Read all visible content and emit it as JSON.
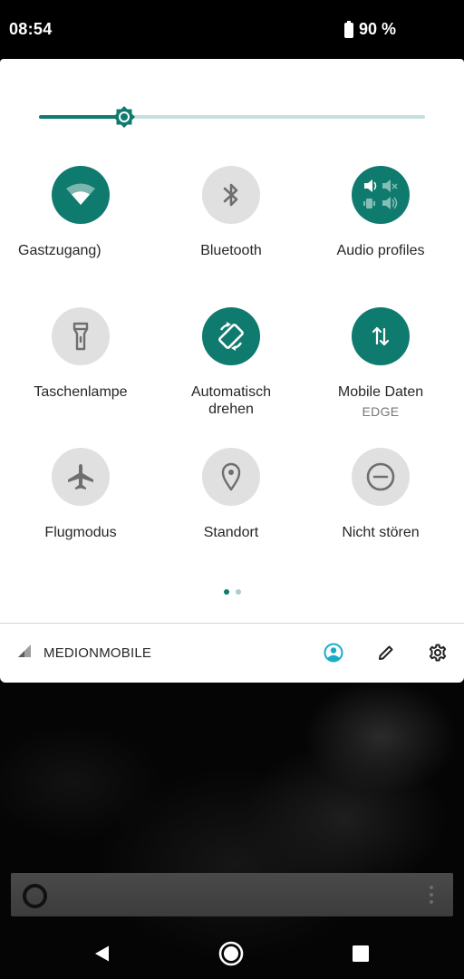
{
  "status_bar": {
    "time": "08:54",
    "battery_percent": "90 %"
  },
  "brightness": {
    "level": 0.22
  },
  "tiles": [
    {
      "label": "Gastzugang)",
      "sub": "",
      "state": "on",
      "icon": "wifi-icon"
    },
    {
      "label": "Bluetooth",
      "sub": "",
      "state": "off",
      "icon": "bluetooth-icon"
    },
    {
      "label": "Audio profiles",
      "sub": "",
      "state": "on",
      "icon": "audio-profiles-icon"
    },
    {
      "label": "Taschenlampe",
      "sub": "",
      "state": "off",
      "icon": "flashlight-icon"
    },
    {
      "label": "Automatisch\ndrehen",
      "sub": "",
      "state": "on",
      "icon": "auto-rotate-icon"
    },
    {
      "label": "Mobile Daten",
      "sub": "EDGE",
      "state": "on",
      "icon": "mobile-data-icon"
    },
    {
      "label": "Flugmodus",
      "sub": "",
      "state": "off",
      "icon": "airplane-icon"
    },
    {
      "label": "Standort",
      "sub": "",
      "state": "off",
      "icon": "location-icon"
    },
    {
      "label": "Nicht stören",
      "sub": "",
      "state": "off",
      "icon": "do-not-disturb-icon"
    }
  ],
  "page_indicator": {
    "current": 1,
    "total": 2
  },
  "footer": {
    "carrier": "MEDIONMOBILE",
    "icons": [
      "user-icon",
      "edit-icon",
      "settings-icon"
    ]
  },
  "colors": {
    "accent": "#0f7a6e",
    "tile_off": "#e0e0e0",
    "user_icon": "#19a9c9"
  }
}
